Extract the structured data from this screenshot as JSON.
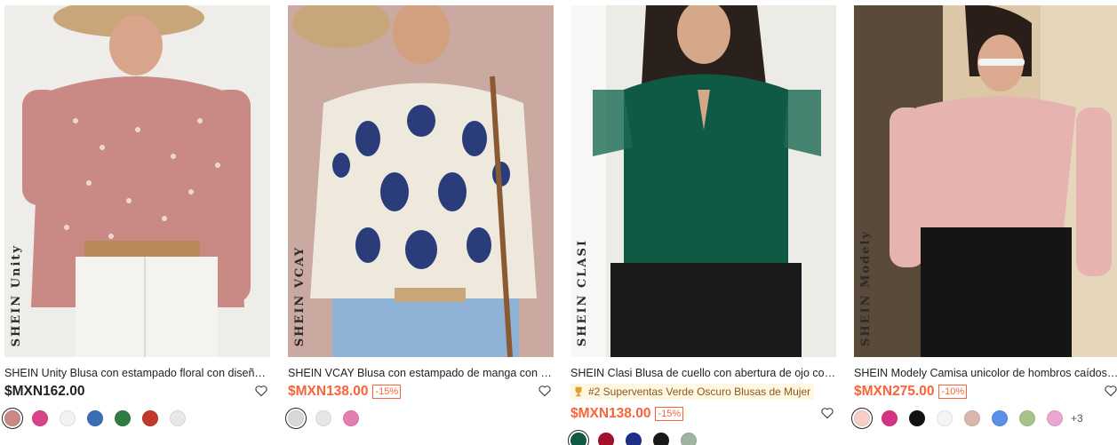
{
  "products": [
    {
      "brand_mark": "SHEIN Unity",
      "title": "SHEIN Unity Blusa con estampado floral con diseño ...",
      "price": "$MXN162.00",
      "discount": "",
      "rank": "",
      "swatches": [
        "#c98a86",
        "#d8448a",
        "#f2f2f2",
        "#3b6fb5",
        "#2e7d44",
        "#c0392b",
        "#e8e8e8"
      ],
      "more": ""
    },
    {
      "brand_mark": "SHEIN VCAY",
      "title": "SHEIN VCAY Blusa con estampado de manga con vo...",
      "price": "$MXN138.00",
      "discount": "-15%",
      "rank": "",
      "swatches": [
        "#d9d9d9",
        "#e6e6e6",
        "#e37fb0"
      ],
      "more": ""
    },
    {
      "brand_mark": "SHEIN CLASI",
      "title": "SHEIN Clasi Blusa de cuello con abertura de ojo con ...",
      "price": "$MXN138.00",
      "discount": "-15%",
      "rank": "#2 Superventas Verde Oscuro Blusas de Mujer",
      "swatches": [
        "#0f5a44",
        "#a3112b",
        "#1d2f8a",
        "#1a1a1a",
        "#9db5a0"
      ],
      "more": ""
    },
    {
      "brand_mark": "SHEIN Modely",
      "title": "SHEIN Modely Camisa unicolor de hombros caídos c...",
      "price": "$MXN275.00",
      "discount": "-10%",
      "rank": "",
      "swatches": [
        "#f6cfc9",
        "#d63384",
        "#111111",
        "#f4f4f4",
        "#d8b8ae",
        "#5b8fe8",
        "#a6c48a",
        "#e9a7d2"
      ],
      "more": "+3"
    }
  ],
  "colors": {
    "sale": "#fa6338",
    "rank_bg": "#fff7e3"
  }
}
